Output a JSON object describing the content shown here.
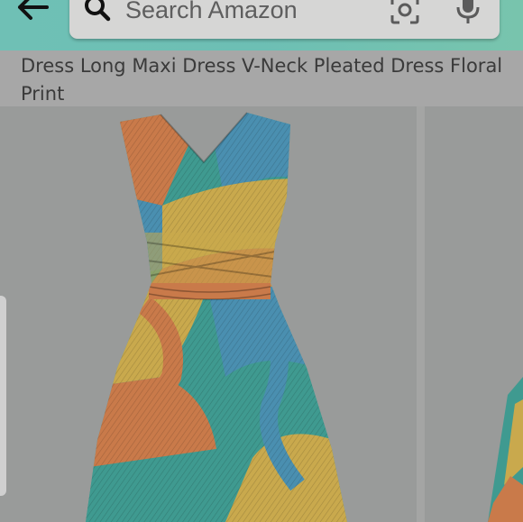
{
  "header": {
    "back_icon": "arrow-left-icon",
    "search": {
      "placeholder": "Search Amazon",
      "search_icon": "magnifier-icon",
      "camera_icon": "camera-scan-icon",
      "mic_icon": "microphone-icon"
    }
  },
  "product": {
    "title": "Dress Long Maxi Dress V-Neck Pleated Dress Floral Print"
  },
  "colors": {
    "header_teal": "#6fc0b5",
    "search_bg": "#d6d6d5",
    "fabric_orange": "#c97a4a",
    "fabric_teal": "#3f9a90",
    "fabric_blue": "#4a8fb0",
    "fabric_gold": "#c9a94d"
  }
}
